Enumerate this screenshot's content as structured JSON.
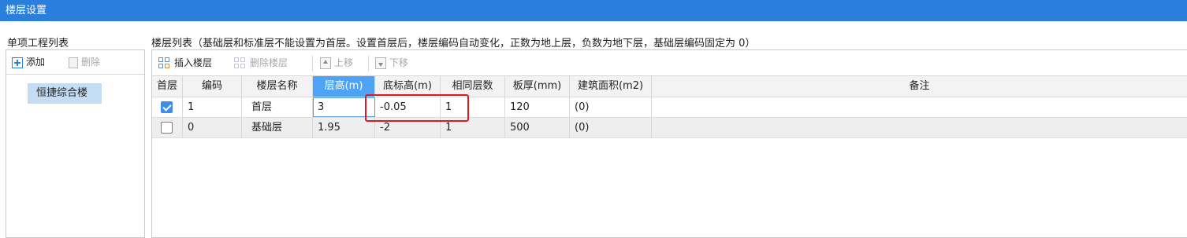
{
  "window": {
    "title": "楼层设置"
  },
  "left": {
    "section_label": "单项工程列表",
    "toolbar": {
      "add_label": "添加",
      "delete_label": "删除"
    },
    "items": [
      {
        "label": "恒捷综合楼",
        "selected": true
      }
    ]
  },
  "right": {
    "section_label": "楼层列表（基础层和标准层不能设置为首层。设置首层后，楼层编码自动变化，正数为地上层，负数为地下层，基础层编码固定为 0）",
    "toolbar": {
      "insert_label": "插入楼层",
      "delete_label": "删除楼层",
      "up_label": "上移",
      "down_label": "下移"
    },
    "columns": [
      "首层",
      "编码",
      "楼层名称",
      "层高(m)",
      "底标高(m)",
      "相同层数",
      "板厚(mm)",
      "建筑面积(m2)",
      "备注"
    ],
    "active_column": "层高(m)",
    "rows": [
      {
        "first": true,
        "code": "1",
        "name": "首层",
        "height": "3",
        "bottom": "-0.05",
        "same": "1",
        "slab": "120",
        "area": "(0)",
        "note": ""
      },
      {
        "first": false,
        "code": "0",
        "name": "基础层",
        "height": "1.95",
        "bottom": "-2",
        "same": "1",
        "slab": "500",
        "area": "(0)",
        "note": ""
      }
    ]
  },
  "colors": {
    "titlebar": "#2a7fdc",
    "active_header": "#4fa3f7",
    "highlight": "#e0191d",
    "selected_item": "#c5dcf5"
  },
  "icons": {
    "add": "plus-square-icon",
    "delete": "delete-icon",
    "insert": "insert-floor-icon",
    "delete_floor": "delete-floor-icon",
    "up": "arrow-up-icon",
    "down": "arrow-down-icon",
    "checkbox": "checkbox-icon"
  }
}
